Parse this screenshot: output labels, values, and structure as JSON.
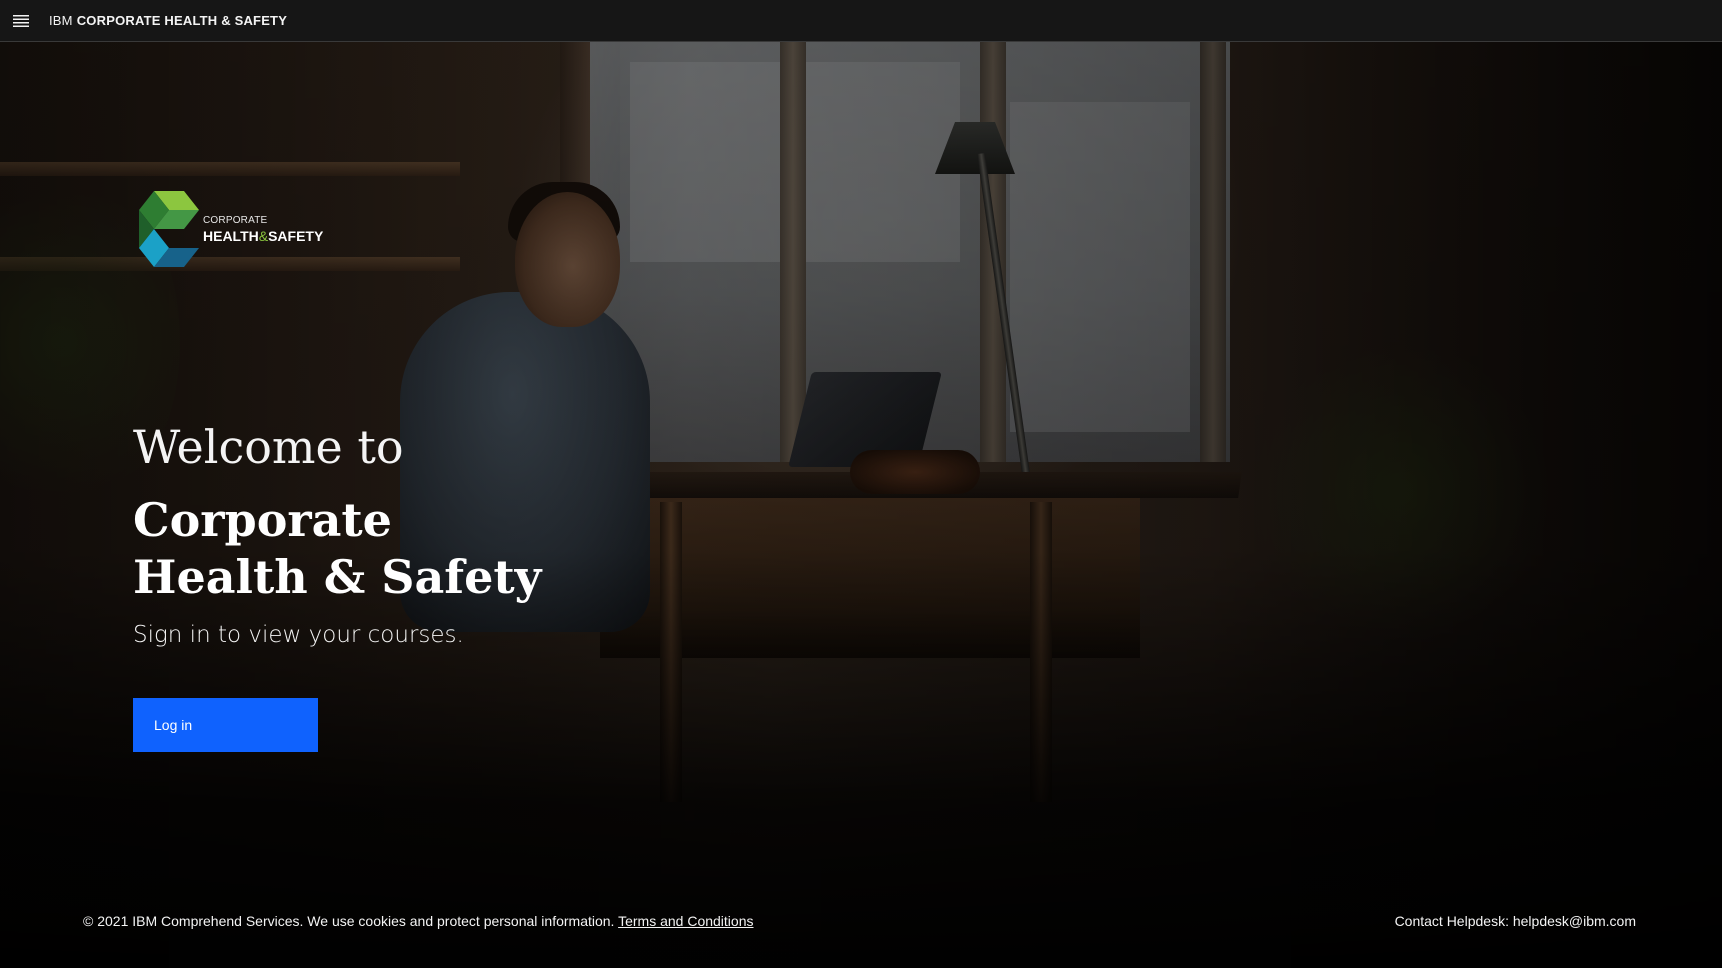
{
  "header": {
    "menu_icon": "hamburger-menu-icon",
    "brand_prefix": "IBM",
    "brand_name": "CORPORATE HEALTH & SAFETY"
  },
  "logo": {
    "line1": "CORPORATE",
    "line2_part1": "HEALTH",
    "line2_amp": "&",
    "line2_part2": "SAFETY",
    "colors": [
      "#2e7d32",
      "#8cc63f",
      "#1ba1c7",
      "#17628a"
    ]
  },
  "hero": {
    "welcome": "Welcome to",
    "title": "Corporate Health & Safety",
    "subtitle": "Sign in to view your courses.",
    "login_label": "Log in",
    "login_color": "#0f62fe"
  },
  "footer": {
    "copyright": "© 2021 IBM Comprehend Services. We use cookies and protect personal information.",
    "terms_link": "Terms and Conditions",
    "contact": "Contact Helpdesk: helpdesk@ibm.com"
  }
}
